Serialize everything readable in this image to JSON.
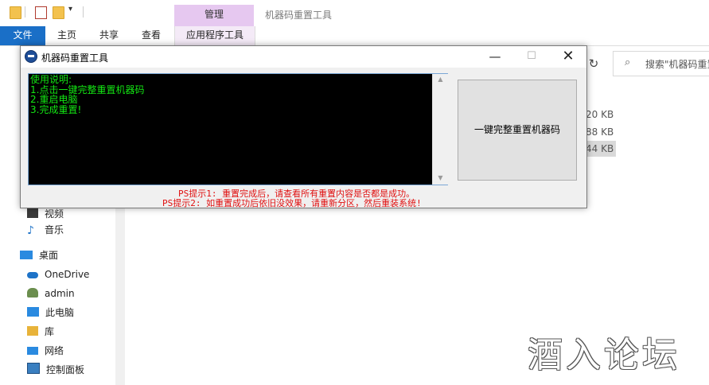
{
  "explorer": {
    "title": "机器码重置工具",
    "ribbon_context_header": "管理",
    "tabs": [
      "文件",
      "主页",
      "共享",
      "查看",
      "应用程序工具"
    ],
    "search_placeholder": "搜索\"机器码重置",
    "refresh_glyph": "↻",
    "file_sizes": [
      "20 KB",
      "88 KB",
      "44 KB"
    ],
    "nav_items": [
      {
        "label": "视频",
        "icon": "video-icon",
        "color": "#3a3a3a"
      },
      {
        "label": "音乐",
        "icon": "music-icon",
        "color": "#1e73c8"
      },
      {
        "label": "桌面",
        "icon": "desktop-icon",
        "color": "#2a8ae0"
      },
      {
        "label": "OneDrive",
        "icon": "onedrive-icon",
        "color": "#1e73c8"
      },
      {
        "label": "admin",
        "icon": "user-icon",
        "color": "#6b8e4e"
      },
      {
        "label": "此电脑",
        "icon": "computer-icon",
        "color": "#2a8ae0"
      },
      {
        "label": "库",
        "icon": "library-icon",
        "color": "#e8b33a"
      },
      {
        "label": "网络",
        "icon": "network-icon",
        "color": "#2a8ae0"
      },
      {
        "label": "控制面板",
        "icon": "control-panel-icon",
        "color": "#3a7fc0"
      }
    ]
  },
  "tool_window": {
    "title": "机器码重置工具",
    "minimize_glyph": "—",
    "maximize_glyph": "☐",
    "close_glyph": "✕",
    "console_lines": [
      "使用说明:",
      "1.点击一键完整重置机器码",
      "2.重启电脑",
      "3.完成重置!"
    ],
    "reset_button_label": "一键完整重置机器码",
    "hint_1": "PS提示1: 重置完成后，请查看所有重置内容是否都是成功。",
    "hint_2": "PS提示2: 如重置成功后依旧没效果，请重新分区，然后重装系统!"
  },
  "watermark": "酒入论坛",
  "colors": {
    "console_text": "#13e613",
    "hint_text": "#e01010",
    "file_tab": "#1a6fc7",
    "manage_header": "#e6c8f0"
  }
}
